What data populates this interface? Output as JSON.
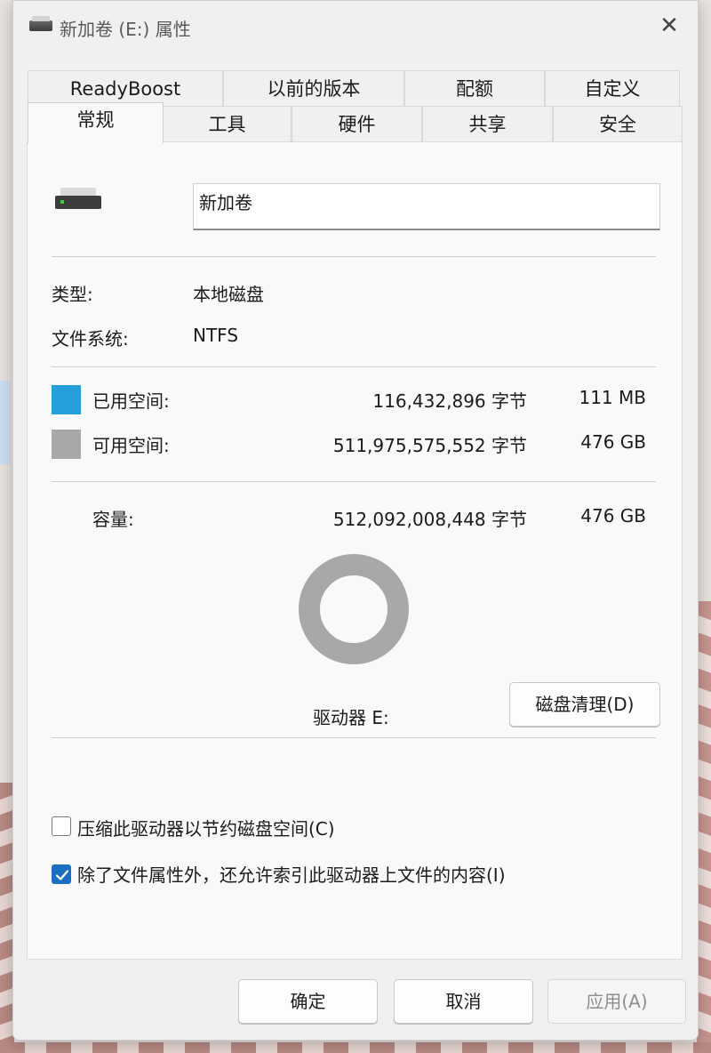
{
  "window": {
    "title": "新加卷 (E:) 属性",
    "close_glyph": "✕"
  },
  "tabs_row1": [
    {
      "label": "ReadyBoost"
    },
    {
      "label": "以前的版本"
    },
    {
      "label": "配额"
    },
    {
      "label": "自定义"
    }
  ],
  "tabs_row2": [
    {
      "label": "常规",
      "active": true
    },
    {
      "label": "工具"
    },
    {
      "label": "硬件"
    },
    {
      "label": "共享"
    },
    {
      "label": "安全"
    }
  ],
  "general": {
    "volume_name": "新加卷",
    "type_label": "类型:",
    "type_value": "本地磁盘",
    "fs_label": "文件系统:",
    "fs_value": "NTFS",
    "used": {
      "label": "已用空间:",
      "bytes": "116,432,896 字节",
      "size": "111 MB",
      "color": "#26a0da"
    },
    "free": {
      "label": "可用空间:",
      "bytes": "511,975,575,552 字节",
      "size": "476 GB",
      "color": "#a8a8a8"
    },
    "capacity": {
      "label": "容量:",
      "bytes": "512,092,008,448 字节",
      "size": "476 GB"
    },
    "used_fraction": 0.000227,
    "drive_label": "驱动器 E:",
    "cleanup_button": "磁盘清理(D)",
    "compress_label": "压缩此驱动器以节约磁盘空间(C)",
    "compress_checked": false,
    "index_label": "除了文件属性外，还允许索引此驱动器上文件的内容(I)",
    "index_checked": true
  },
  "buttons": {
    "ok": "确定",
    "cancel": "取消",
    "apply": "应用(A)"
  }
}
